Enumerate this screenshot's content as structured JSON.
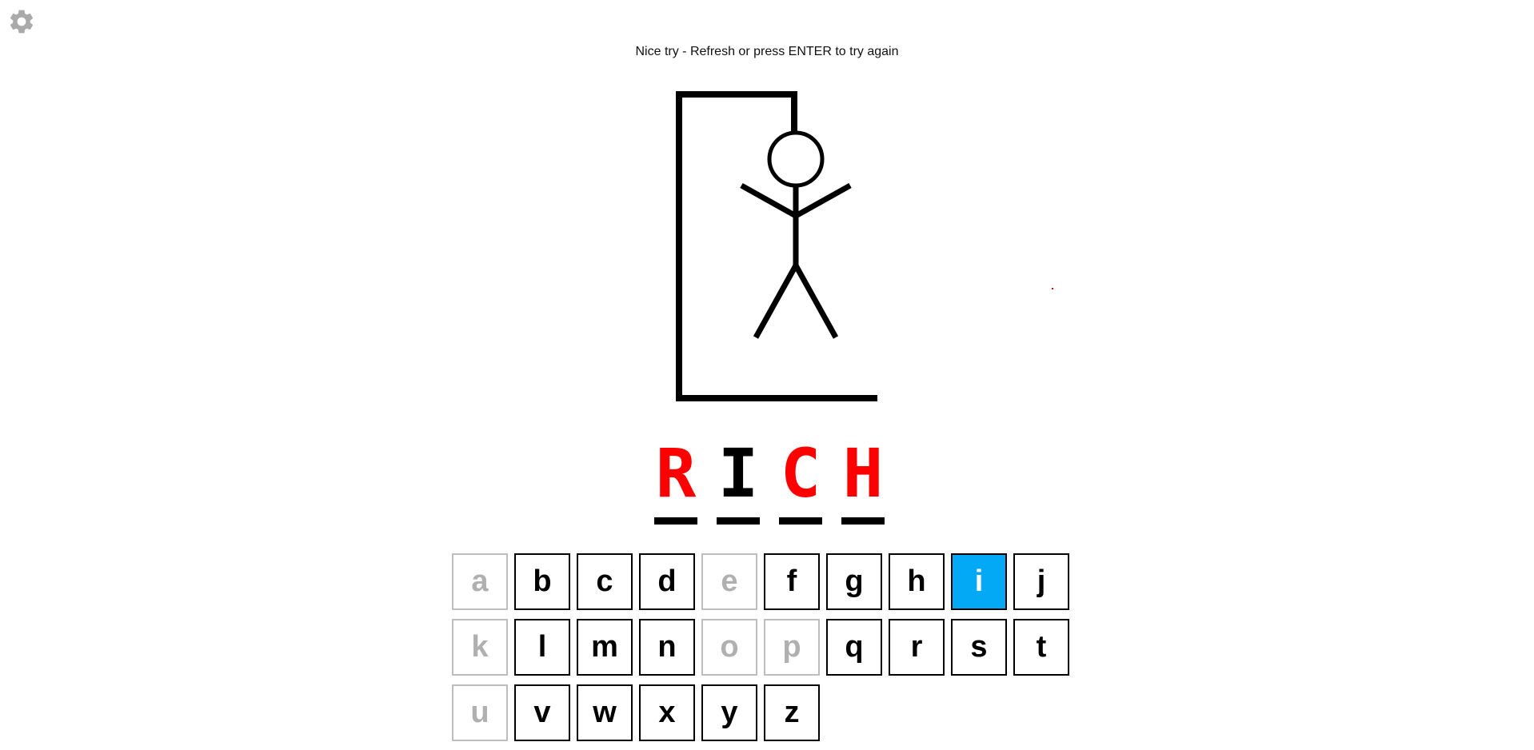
{
  "settings": {
    "icon": "gear-icon",
    "color": "#aaaaaa"
  },
  "status_message": "Nice try - Refresh or press ENTER to try again",
  "word": {
    "letters": [
      {
        "char": "R",
        "state": "missed",
        "color": "#ff0000"
      },
      {
        "char": "I",
        "state": "guessed",
        "color": "#000000"
      },
      {
        "char": "C",
        "state": "missed",
        "color": "#ff0000"
      },
      {
        "char": "H",
        "state": "missed",
        "color": "#ff0000"
      }
    ]
  },
  "keyboard": {
    "rows": [
      [
        {
          "letter": "a",
          "state": "used"
        },
        {
          "letter": "b",
          "state": "available"
        },
        {
          "letter": "c",
          "state": "available"
        },
        {
          "letter": "d",
          "state": "available"
        },
        {
          "letter": "e",
          "state": "used"
        },
        {
          "letter": "f",
          "state": "available"
        },
        {
          "letter": "g",
          "state": "available"
        },
        {
          "letter": "h",
          "state": "available"
        },
        {
          "letter": "i",
          "state": "active"
        },
        {
          "letter": "j",
          "state": "available"
        }
      ],
      [
        {
          "letter": "k",
          "state": "used"
        },
        {
          "letter": "l",
          "state": "available"
        },
        {
          "letter": "m",
          "state": "available"
        },
        {
          "letter": "n",
          "state": "available"
        },
        {
          "letter": "o",
          "state": "used"
        },
        {
          "letter": "p",
          "state": "used"
        },
        {
          "letter": "q",
          "state": "available"
        },
        {
          "letter": "r",
          "state": "available"
        },
        {
          "letter": "s",
          "state": "available"
        },
        {
          "letter": "t",
          "state": "available"
        }
      ],
      [
        {
          "letter": "u",
          "state": "used"
        },
        {
          "letter": "v",
          "state": "available"
        },
        {
          "letter": "w",
          "state": "available"
        },
        {
          "letter": "x",
          "state": "available"
        },
        {
          "letter": "y",
          "state": "available"
        },
        {
          "letter": "z",
          "state": "available"
        }
      ]
    ],
    "active_color": "#03a9f4"
  },
  "hangman": {
    "parts_shown": [
      "head",
      "body",
      "left-arm",
      "right-arm",
      "left-leg",
      "right-leg"
    ]
  }
}
